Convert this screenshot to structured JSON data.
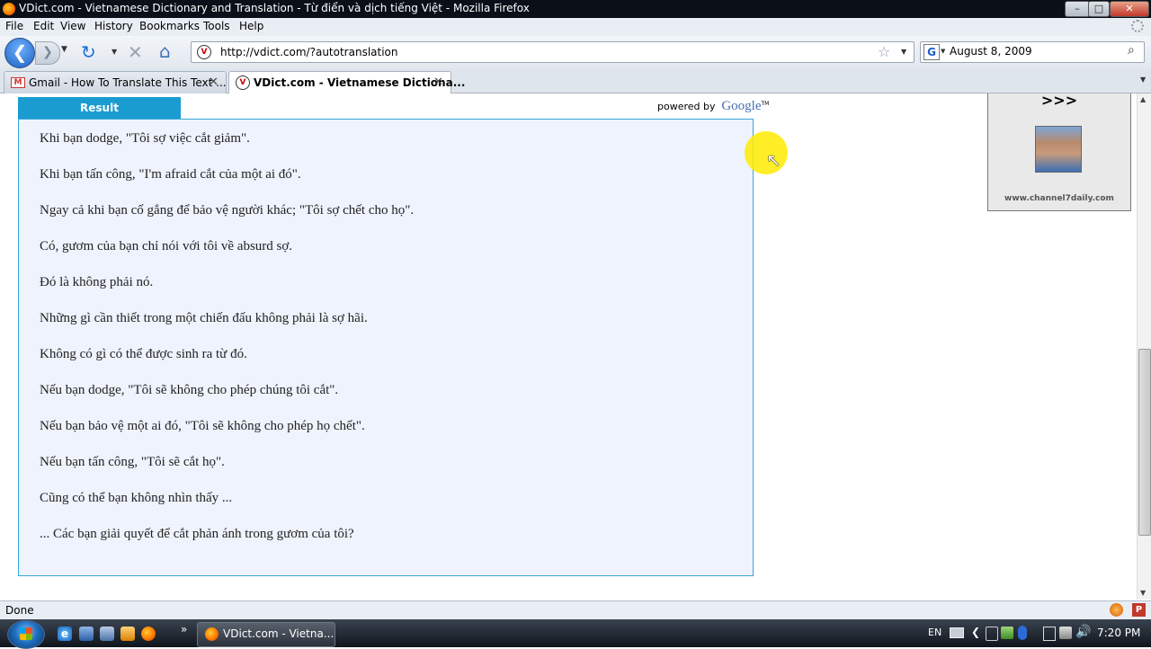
{
  "window": {
    "title": "VDict.com - Vietnamese Dictionary and Translation - Từ điển và dịch tiếng Việt - Mozilla Firefox",
    "minimize": "–",
    "maximize": "□",
    "close": "✕"
  },
  "menu": [
    "File",
    "Edit",
    "View",
    "History",
    "Bookmarks",
    "Tools",
    "Help"
  ],
  "nav": {
    "url": "http://vdict.com/?autotranslation",
    "search_value": "August 8, 2009",
    "search_engine_letter": "G"
  },
  "tabs": [
    {
      "label": "Gmail - How To Translate This Text ...",
      "close": "✕"
    },
    {
      "label": "VDict.com - Vietnamese Dictiona...",
      "close": "✕"
    }
  ],
  "content": {
    "result_tab": "Result",
    "powered_by": "powered by",
    "google_logo": "Google",
    "lines": [
      "Khi bạn dodge, \"Tôi sợ việc cắt giảm\".",
      "Khi bạn tấn công, \"I'm afraid cắt của một ai đó\".",
      "Ngay cả khi bạn cố gắng để bảo vệ người khác; \"Tôi sợ chết cho họ\".",
      "Có, gươm của bạn chỉ nói với tôi về absurd sợ.",
      "Đó là không phải nó.",
      "Những gì cần thiết trong một chiến đấu không phải là sợ hãi.",
      "Không có gì có thể được sinh ra từ đó.",
      "Nếu bạn dodge, \"Tôi sẽ không cho phép chúng tôi cắt\".",
      "Nếu bạn bảo vệ một ai đó, \"Tôi sẽ không cho phép họ chết\".",
      "Nếu bạn tấn công, \"Tôi sẽ cắt họ\".",
      "Cũng có thể bạn không nhìn thấy ...",
      "... Các bạn giải quyết để cắt phản ánh trong gươm của tôi?"
    ],
    "ad": {
      "arrows": ">>>",
      "site": "www.channel7daily.com"
    }
  },
  "status": {
    "text": "Done"
  },
  "taskbar": {
    "active_window": "VDict.com - Vietna...",
    "language": "EN",
    "time": "7:20 PM",
    "chevron": "»"
  },
  "colors": {
    "result_tab": "#1a9cd0",
    "result_bg": "#eef3fd",
    "result_border": "#39a7d8"
  }
}
